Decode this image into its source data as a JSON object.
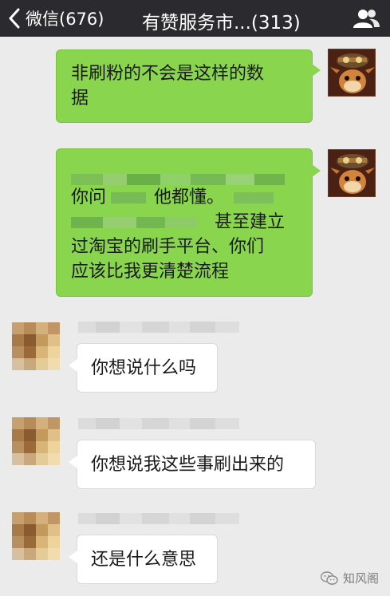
{
  "header": {
    "back_label": "微信(676)",
    "title": "有赞服务市...(313)"
  },
  "messages": [
    {
      "side": "right",
      "lines": [
        "非刷粉的不会是这样的数",
        "据"
      ]
    },
    {
      "side": "right",
      "lines": [
        "",
        "你问 ▒ 他都懂。",
        "▒ 甚至建立",
        "过淘宝的刷手平台、你们",
        "应该比我更清楚流程"
      ]
    },
    {
      "side": "left",
      "text": "你想说什么吗"
    },
    {
      "side": "left",
      "text": "你想说我这些事刷出来的"
    },
    {
      "side": "left",
      "text": "还是什么意思"
    }
  ],
  "msg2": {
    "l2a": "你问",
    "l2b": "他都懂。",
    "l3": "甚至建立",
    "l4": "过淘宝的刷手平台、你们",
    "l5": "应该比我更清楚流程"
  },
  "watermark": {
    "text": "知风阁"
  },
  "colors": {
    "header_bg": "#2b2b2f",
    "chat_bg": "#ebebeb",
    "green_bubble": "#8ad54e",
    "white_bubble": "#ffffff"
  },
  "icons": {
    "back": "chevron-left-icon",
    "contacts": "contacts-icon",
    "watermark": "wechat-logo-icon"
  }
}
